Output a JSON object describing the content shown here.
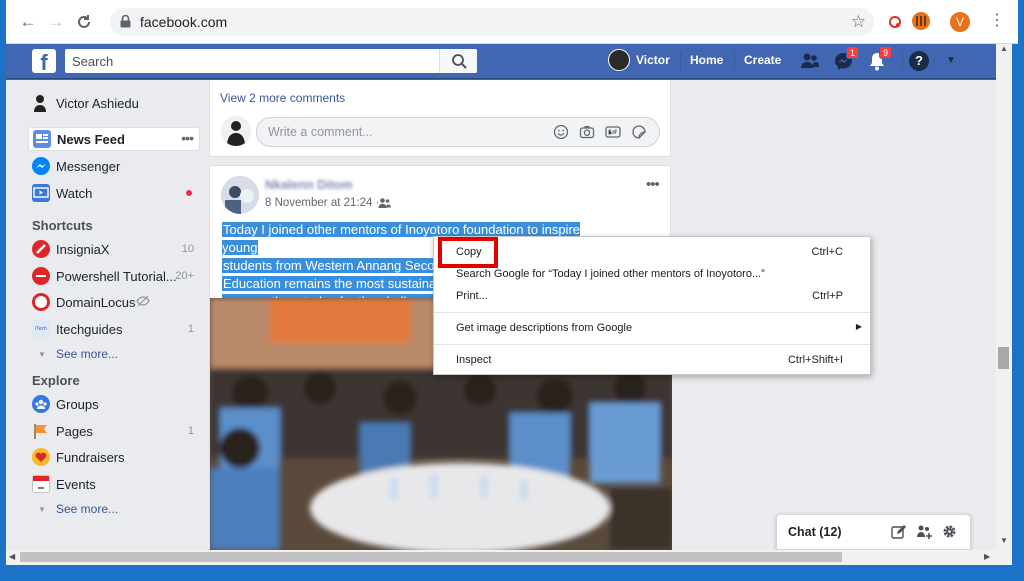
{
  "browser": {
    "url": "facebook.com",
    "profile_initial": "V"
  },
  "fb_header": {
    "logo": "f",
    "search_placeholder": "Search",
    "profile_name": "Victor",
    "home_label": "Home",
    "create_label": "Create",
    "messenger_badge": "1",
    "notifications_badge": "9"
  },
  "sidebar": {
    "profile_name": "Victor Ashiedu",
    "main_items": [
      {
        "label": "News Feed",
        "icon": "news-feed-icon"
      },
      {
        "label": "Messenger",
        "icon": "messenger-icon"
      },
      {
        "label": "Watch",
        "icon": "watch-icon"
      }
    ],
    "shortcuts_heading": "Shortcuts",
    "shortcuts": [
      {
        "label": "InsigniaX",
        "count": "10"
      },
      {
        "label": "Powershell Tutorial...",
        "count": "20+"
      },
      {
        "label": "DomainLocus",
        "count": ""
      },
      {
        "label": "Itechguides",
        "count": "1"
      }
    ],
    "see_more": "See more...",
    "explore_heading": "Explore",
    "explore": [
      {
        "label": "Groups",
        "count": ""
      },
      {
        "label": "Pages",
        "count": "1"
      },
      {
        "label": "Fundraisers",
        "count": ""
      },
      {
        "label": "Events",
        "count": ""
      }
    ],
    "see_more_2": "See more...",
    "colors": {
      "watch_dot": "#f02849",
      "link": "#385898"
    }
  },
  "feed": {
    "view_comments": "View 2 more comments",
    "comment_placeholder": "Write a comment...",
    "post": {
      "author": "Nkalenn Ditom",
      "timestamp": "8 November at 21:24 ·",
      "text_lines": [
        "Today I joined other mentors of Inoyotoro foundation to inspire young",
        "students from Western Annang Seco",
        "Education remains the most sustaina",
        "prepare them today for the challenge"
      ]
    }
  },
  "context_menu": {
    "items": [
      {
        "label": "Copy",
        "shortcut": "Ctrl+C"
      },
      {
        "label": "Search Google for “Today I joined other mentors of Inoyotoro...”",
        "shortcut": ""
      },
      {
        "label": "Print...",
        "shortcut": "Ctrl+P"
      },
      {
        "label": "Get image descriptions from Google",
        "shortcut": ""
      },
      {
        "label": "Inspect",
        "shortcut": "Ctrl+Shift+I"
      }
    ],
    "highlight_color": "#e00000"
  },
  "chat": {
    "label": "Chat (12)"
  }
}
